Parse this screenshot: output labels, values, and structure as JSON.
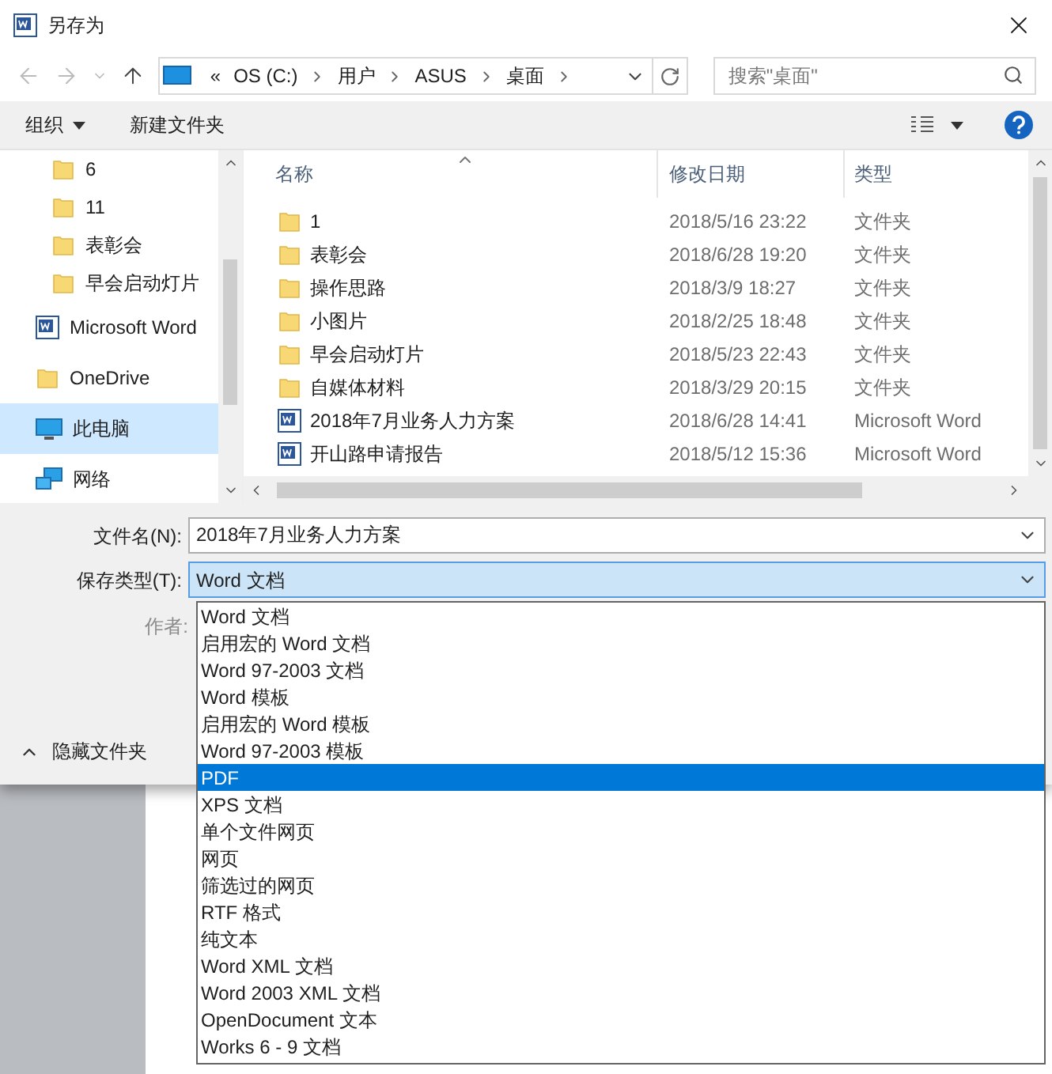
{
  "window": {
    "title": "另存为"
  },
  "address_bar": {
    "segments": [
      "«",
      "OS (C:)",
      "用户",
      "ASUS",
      "桌面"
    ]
  },
  "search": {
    "placeholder": "搜索\"桌面\""
  },
  "toolbar": {
    "organize": "组织",
    "new_folder": "新建文件夹"
  },
  "sidebar": {
    "items": [
      {
        "label": "6",
        "kind": "folder",
        "selected": false
      },
      {
        "label": "11",
        "kind": "folder",
        "selected": false
      },
      {
        "label": "表彰会",
        "kind": "folder",
        "selected": false
      },
      {
        "label": "早会启动灯片",
        "kind": "folder",
        "selected": false
      },
      {
        "label": "Microsoft Word",
        "kind": "word",
        "selected": false
      },
      {
        "label": "OneDrive",
        "kind": "cloud",
        "selected": false
      },
      {
        "label": "此电脑",
        "kind": "pc",
        "selected": true
      },
      {
        "label": "网络",
        "kind": "network",
        "selected": false
      }
    ]
  },
  "file_list": {
    "columns": [
      "名称",
      "修改日期",
      "类型"
    ],
    "rows": [
      {
        "name": "1",
        "date": "2018/5/16 23:22",
        "type": "文件夹",
        "kind": "folder"
      },
      {
        "name": "表彰会",
        "date": "2018/6/28 19:20",
        "type": "文件夹",
        "kind": "folder"
      },
      {
        "name": "操作思路",
        "date": "2018/3/9 18:27",
        "type": "文件夹",
        "kind": "folder"
      },
      {
        "name": "小图片",
        "date": "2018/2/25 18:48",
        "type": "文件夹",
        "kind": "folder"
      },
      {
        "name": "早会启动灯片",
        "date": "2018/5/23 22:43",
        "type": "文件夹",
        "kind": "folder"
      },
      {
        "name": "自媒体材料",
        "date": "2018/3/29 20:15",
        "type": "文件夹",
        "kind": "folder"
      },
      {
        "name": "2018年7月业务人力方案",
        "date": "2018/6/28 14:41",
        "type": "Microsoft Word",
        "kind": "word"
      },
      {
        "name": "开山路申请报告",
        "date": "2018/5/12 15:36",
        "type": "Microsoft Word",
        "kind": "word"
      }
    ]
  },
  "form": {
    "filename_label": "文件名(N):",
    "filename": "2018年7月业务人力方案",
    "type_label": "保存类型(T):",
    "type_value": "Word 文档",
    "author_label": "作者:",
    "hide_folders": "隐藏文件夹"
  },
  "type_dropdown": {
    "expanded": true,
    "options": [
      {
        "label": "Word 文档",
        "selected": false
      },
      {
        "label": "启用宏的 Word 文档",
        "selected": false
      },
      {
        "label": "Word 97-2003 文档",
        "selected": false
      },
      {
        "label": "Word 模板",
        "selected": false
      },
      {
        "label": "启用宏的 Word 模板",
        "selected": false
      },
      {
        "label": "Word 97-2003 模板",
        "selected": false
      },
      {
        "label": "PDF",
        "selected": true
      },
      {
        "label": "XPS 文档",
        "selected": false
      },
      {
        "label": "单个文件网页",
        "selected": false
      },
      {
        "label": "网页",
        "selected": false
      },
      {
        "label": "筛选过的网页",
        "selected": false
      },
      {
        "label": "RTF 格式",
        "selected": false
      },
      {
        "label": "纯文本",
        "selected": false
      },
      {
        "label": "Word XML 文档",
        "selected": false
      },
      {
        "label": "Word 2003 XML 文档",
        "selected": false
      },
      {
        "label": "OpenDocument 文本",
        "selected": false
      },
      {
        "label": "Works 6 - 9 文档",
        "selected": false
      }
    ]
  }
}
